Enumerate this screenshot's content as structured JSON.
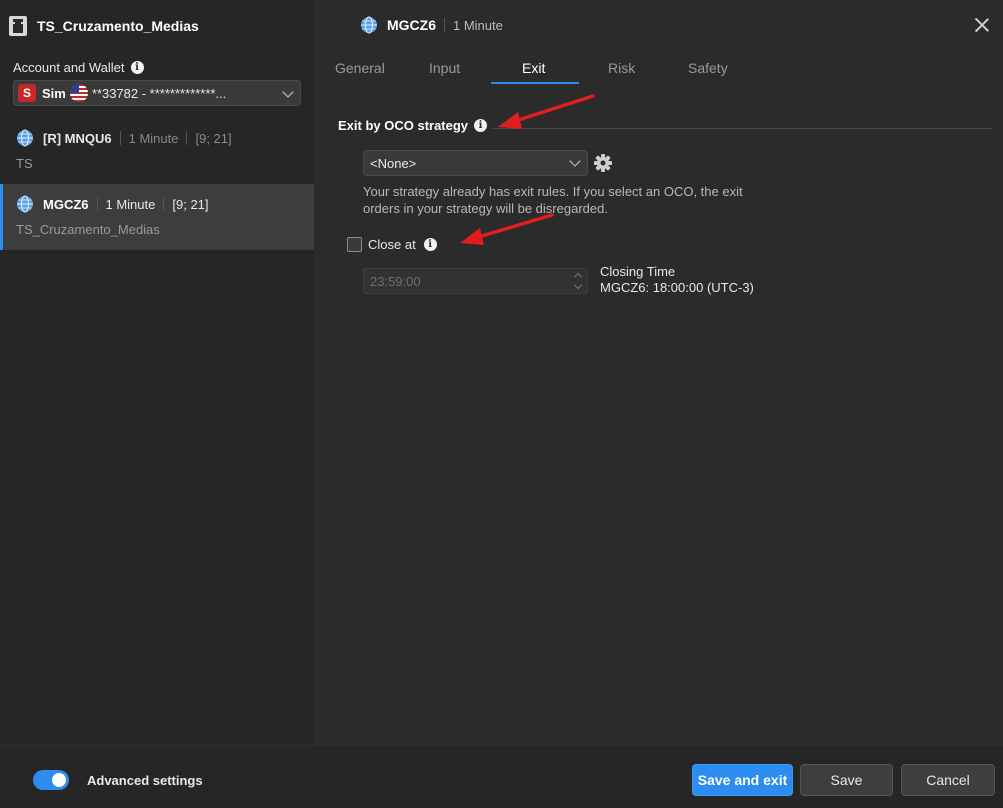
{
  "sidebar": {
    "title": "TS_Cruzamento_Medias",
    "account_label": "Account and Wallet",
    "account": {
      "badge": "S",
      "type": "Sim",
      "value": "**33782 - *************..."
    },
    "strategies": [
      {
        "symbol": "[R] MNQU6",
        "interval": "1 Minute",
        "params": "[9; 21]",
        "name": "TS"
      },
      {
        "symbol": "MGCZ6",
        "interval": "1 Minute",
        "params": "[9; 21]",
        "name": "TS_Cruzamento_Medias"
      }
    ]
  },
  "header": {
    "symbol": "MGCZ6",
    "interval": "1 Minute"
  },
  "tabs": [
    {
      "label": "General"
    },
    {
      "label": "Input"
    },
    {
      "label": "Exit"
    },
    {
      "label": "Risk"
    },
    {
      "label": "Safety"
    }
  ],
  "exit": {
    "section_title": "Exit by OCO strategy",
    "oco_selected": "<None>",
    "oco_hint_line1": "Your strategy already has exit rules. If you select an OCO, the exit",
    "oco_hint_line2": "orders in your strategy will be disregarded.",
    "close_at_label": "Close at",
    "close_at_checked": false,
    "close_time_value": "23:59:00",
    "closing_time_label": "Closing Time",
    "closing_time_detail": "MGCZ6: 18:00:00 (UTC-3)"
  },
  "footer": {
    "advanced_label": "Advanced settings",
    "advanced_enabled": true,
    "save_exit_label": "Save and exit",
    "save_label": "Save",
    "cancel_label": "Cancel"
  },
  "colors": {
    "accent": "#2d8cf0",
    "annotation_arrow": "#e01e1e",
    "sim_badge": "#c62828"
  },
  "icons": [
    "app-logo-icon",
    "info-icon",
    "globe-icon",
    "chevron-down-icon",
    "gear-icon",
    "close-icon",
    "us-flag-icon",
    "spinner-up-icon",
    "spinner-down-icon"
  ]
}
